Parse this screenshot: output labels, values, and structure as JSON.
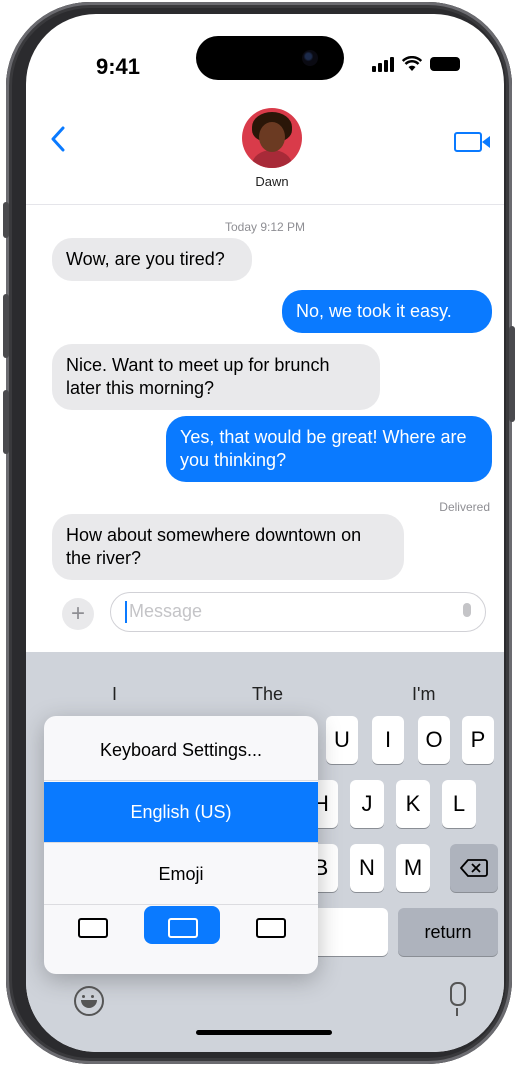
{
  "status": {
    "time": "9:41"
  },
  "header": {
    "contact_name": "Dawn"
  },
  "conversation": {
    "timestamp": "Today 9:12 PM",
    "messages": [
      {
        "side": "in",
        "text": "Wow, are you tired?"
      },
      {
        "side": "out",
        "text": "No, we took it easy."
      },
      {
        "side": "in",
        "text": "Nice. Want to meet up for brunch later this morning?"
      },
      {
        "side": "out",
        "text": "Yes, that would be great! Where are you thinking?"
      },
      {
        "side": "in",
        "text": "How about somewhere downtown on the river?"
      }
    ],
    "delivered": "Delivered"
  },
  "composer": {
    "placeholder": "Message"
  },
  "keyboard": {
    "predictions": [
      "I",
      "The",
      "I'm"
    ],
    "row1_visible": [
      "U",
      "I",
      "O",
      "P"
    ],
    "row2_visible": [
      "H",
      "J",
      "K",
      "L"
    ],
    "row3_visible": [
      "B",
      "N",
      "M"
    ],
    "return_label": "return"
  },
  "keyboard_menu": {
    "items": [
      "Keyboard Settings...",
      "English (US)",
      "Emoji"
    ],
    "selected": "English (US)"
  },
  "colors": {
    "accent": "#0a7aff",
    "incoming_bubble": "#e9e9eb",
    "keyboard_bg": "#cfd3da"
  }
}
